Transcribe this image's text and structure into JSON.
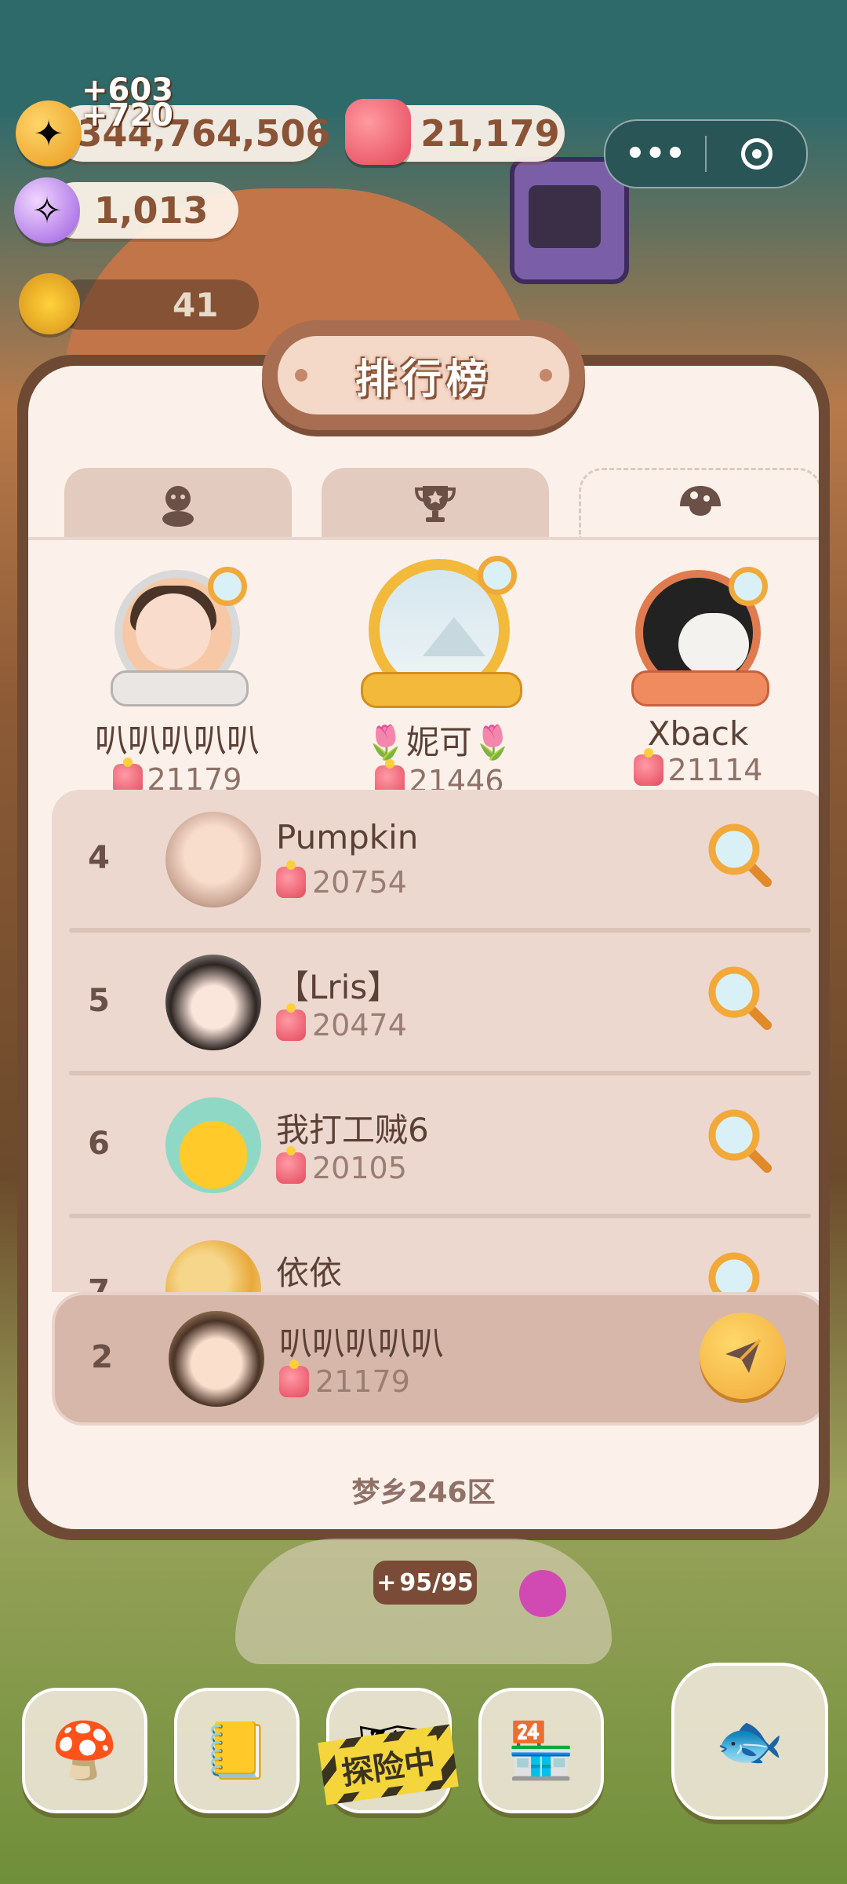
{
  "hud": {
    "coins": "344,764,506",
    "coin_gain_1": "+603",
    "coin_gain_2": "+720",
    "cakes": "21,179",
    "gems": "1,013",
    "sun_count": "41"
  },
  "miniprogram_menu": {
    "more_icon": "•••",
    "close_icon": "target-icon"
  },
  "leaderboard": {
    "title": "排行榜",
    "tabs": [
      {
        "icon": "character-icon",
        "active": false
      },
      {
        "icon": "trophy-icon",
        "active": false
      },
      {
        "icon": "mushroom-icon",
        "active": true
      }
    ],
    "podium": [
      {
        "place": 2,
        "name": "叭叭叭叭叭",
        "score": "21179",
        "frame": "silver"
      },
      {
        "place": 1,
        "name": "🌷妮可🌷",
        "score": "21446",
        "frame": "gold"
      },
      {
        "place": 3,
        "name": "Xback",
        "score": "21114",
        "frame": "bronze"
      }
    ],
    "rows": [
      {
        "rank": "4",
        "name": "Pumpkin",
        "score": "20754"
      },
      {
        "rank": "5",
        "name": "【Lris】",
        "score": "20474"
      },
      {
        "rank": "6",
        "name": "我打工贼6",
        "score": "20105"
      },
      {
        "rank": "7",
        "name": "依依",
        "score": ""
      }
    ],
    "my_row": {
      "rank": "2",
      "name": "叭叭叭叭叭",
      "score": "21179"
    },
    "server": "梦乡246区"
  },
  "bottom": {
    "energy": "95/95",
    "explore_label": "探险中",
    "dock": [
      "mushroom-house-icon",
      "diary-icon",
      "explore-icon",
      "shop-icon",
      "fish-clock-icon"
    ]
  },
  "colors": {
    "panel_border": "#6e4a35",
    "panel_bg": "#fbf1ea",
    "list_bg": "#ecd8ce",
    "accent_gold": "#f0a93a"
  }
}
